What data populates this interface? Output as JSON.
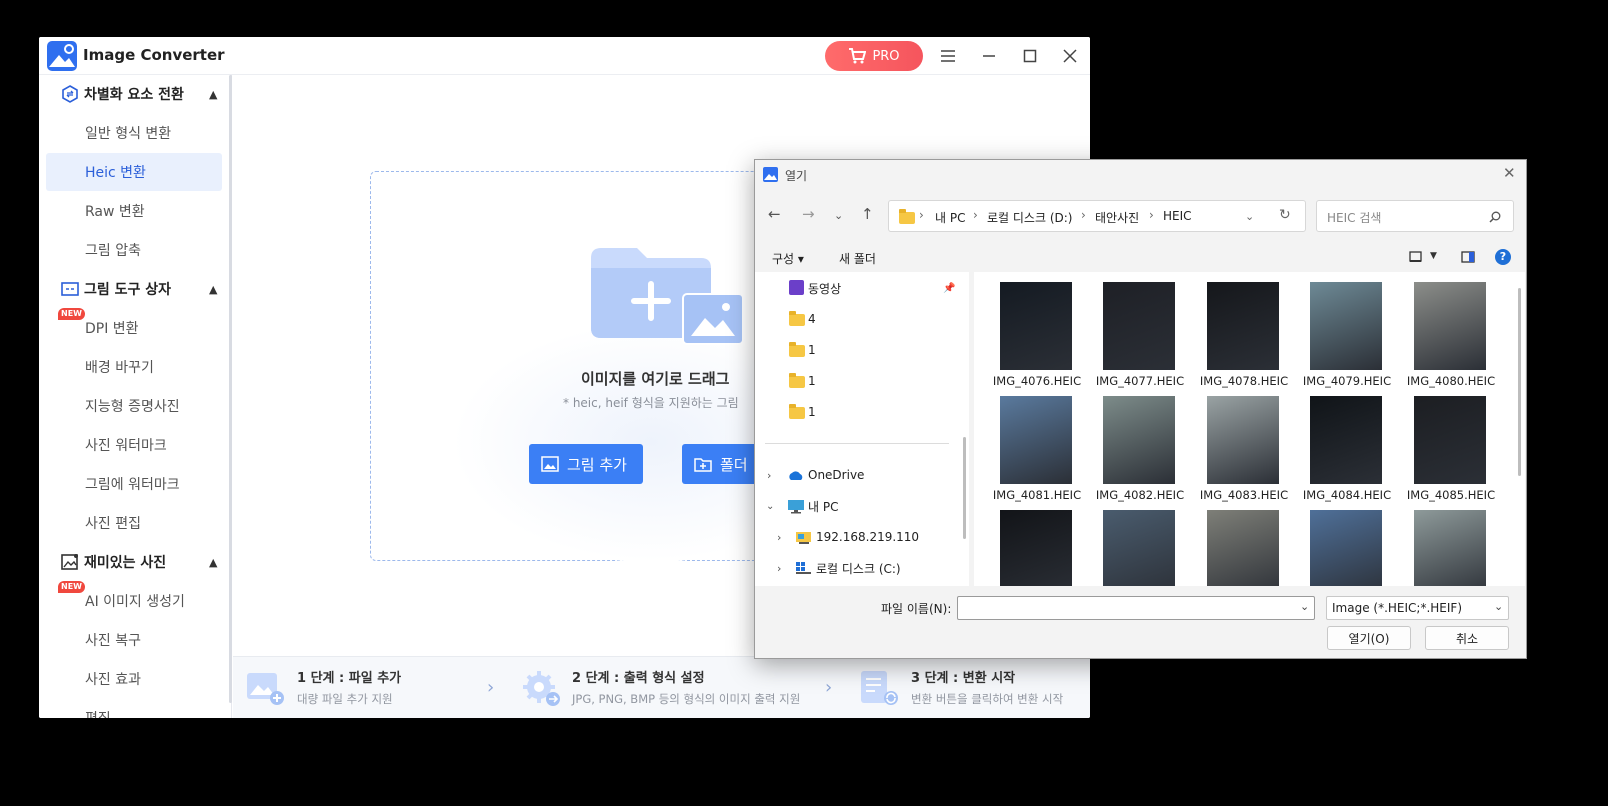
{
  "app": {
    "title": "Image Converter",
    "pro_label": "PRO",
    "sidebar": {
      "sections": [
        {
          "label": "차별화 요소 전환",
          "items": [
            {
              "label": "일반 형식 변환"
            },
            {
              "label": "Heic 변환",
              "active": true
            },
            {
              "label": "Raw 변환"
            },
            {
              "label": "그림 압축"
            }
          ]
        },
        {
          "label": "그림 도구 상자",
          "items": [
            {
              "label": "DPI 변환",
              "badge": "NEW"
            },
            {
              "label": "배경 바꾸기"
            },
            {
              "label": "지능형 증명사진"
            },
            {
              "label": "사진 워터마크"
            },
            {
              "label": "그림에 워터마크"
            },
            {
              "label": "사진 편집"
            }
          ]
        },
        {
          "label": "재미있는 사진",
          "items": [
            {
              "label": "AI 이미지 생성기",
              "badge": "NEW"
            },
            {
              "label": "사진 복구"
            },
            {
              "label": "사진 효과"
            },
            {
              "label": "편집"
            }
          ]
        }
      ]
    },
    "dropzone": {
      "title": "이미지를 여기로 드래그",
      "subtitle": "* heic, heif 형식을 지원하는 그림",
      "add_image_label": "그림 추가",
      "add_folder_label": "폴더"
    },
    "steps": [
      {
        "title": "1 단계 : 파일 추가",
        "desc": "대량 파일 추가 지원"
      },
      {
        "title": "2 단계 : 출력 형식 설정",
        "desc": "JPG, PNG, BMP 등의 형식의 이미지 출력 지원"
      },
      {
        "title": "3 단계 : 변환 시작",
        "desc": "변환 버튼을 클릭하여 변환 시작"
      }
    ]
  },
  "dialog": {
    "title": "열기",
    "breadcrumb": [
      "내 PC",
      "로컬 디스크 (D:)",
      "태안사진",
      "HEIC"
    ],
    "search_placeholder": "HEIC 검색",
    "toolbar": {
      "organize": "구성",
      "new_folder": "새 폴더"
    },
    "tree": [
      {
        "label": "동영상",
        "type": "video"
      },
      {
        "label": "4",
        "type": "folder"
      },
      {
        "label": "1",
        "type": "folder"
      },
      {
        "label": "1",
        "type": "folder"
      },
      {
        "label": "1",
        "type": "folder"
      },
      {
        "label": "OneDrive",
        "type": "cloud"
      },
      {
        "label": "내 PC",
        "type": "pc"
      },
      {
        "label": "192.168.219.110",
        "type": "network"
      },
      {
        "label": "로컬 디스크 (C:)",
        "type": "drive"
      }
    ],
    "files": [
      {
        "name": "IMG_4076.HEIC",
        "tone": "#141a22"
      },
      {
        "name": "IMG_4077.HEIC",
        "tone": "#1e2026"
      },
      {
        "name": "IMG_4078.HEIC",
        "tone": "#15171b"
      },
      {
        "name": "IMG_4079.HEIC",
        "tone": "#6e8a96"
      },
      {
        "name": "IMG_4080.HEIC",
        "tone": "#8c8e8a"
      },
      {
        "name": "IMG_4081.HEIC",
        "tone": "#5a7a9e"
      },
      {
        "name": "IMG_4082.HEIC",
        "tone": "#7d8c8a"
      },
      {
        "name": "IMG_4083.HEIC",
        "tone": "#9aa3a4"
      },
      {
        "name": "IMG_4084.HEIC",
        "tone": "#101418"
      },
      {
        "name": "IMG_4085.HEIC",
        "tone": "#1c1e22"
      },
      {
        "name": "",
        "tone": "#121418"
      },
      {
        "name": "",
        "tone": "#4a5c6e"
      },
      {
        "name": "",
        "tone": "#7e7f78"
      },
      {
        "name": "",
        "tone": "#4f7099"
      },
      {
        "name": "",
        "tone": "#8e9a9a"
      }
    ],
    "filename_label": "파일 이름(N):",
    "filename_value": "",
    "filetype": "Image (*.HEIC;*.HEIF)",
    "open_label": "열기(O)",
    "cancel_label": "취소"
  },
  "colors": {
    "accent": "#3b7ff5",
    "pro": "#f5555d",
    "active_bg": "#e9f0fd"
  }
}
